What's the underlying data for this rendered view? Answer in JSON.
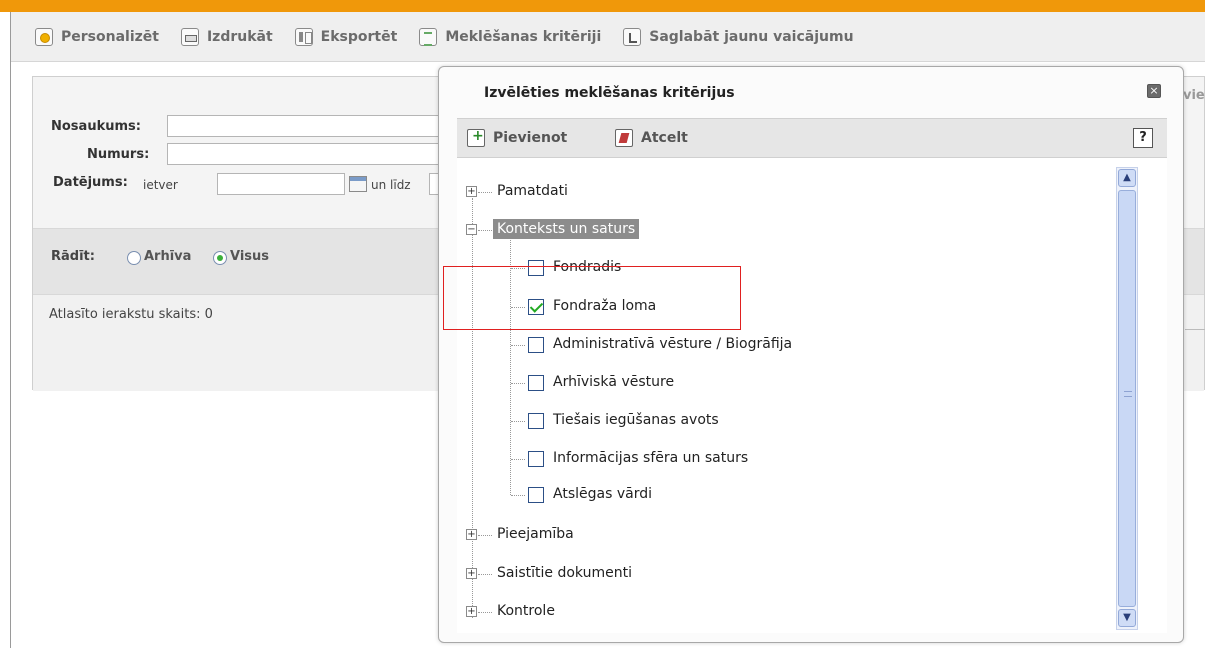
{
  "toolbar": {
    "personalize": "Personalizēt",
    "print": "Izdrukāt",
    "export": "Eksportēt",
    "criteria": "Meklēšanas kritēriji",
    "save_query": "Saglabāt jaunu vaicājumu"
  },
  "form": {
    "name_label": "Nosaukums:",
    "number_label": "Numurs:",
    "date_label": "Datējums:",
    "date_mode": "ietver",
    "date_to": "un līdz"
  },
  "show": {
    "label": "Rādīt:",
    "archive": "Arhīva",
    "all": "Visus"
  },
  "count_label": "Atlasīto ierakstu skaits: 0",
  "side_peek": "vie",
  "modal": {
    "title": "Izvēlēties meklēšanas kritērijus",
    "close": "×",
    "add_label": "Pievienot",
    "cancel_label": "Atcelt",
    "help": "?"
  },
  "tree": {
    "expand_plus": "+",
    "expand_minus": "−",
    "basic": "Pamatdati",
    "context": "Konteksts un saturs",
    "children": [
      {
        "label": "Fondradis",
        "checked": false
      },
      {
        "label": "Fondraža loma",
        "checked": true
      },
      {
        "label": "Administratīvā vēsture / Biogrāfija",
        "checked": false
      },
      {
        "label": "Arhīviskā vēsture",
        "checked": false
      },
      {
        "label": "Tiešais iegūšanas avots",
        "checked": false
      },
      {
        "label": "Informācijas sfēra un saturs",
        "checked": false
      },
      {
        "label": "Atslēgas vārdi",
        "checked": false
      }
    ],
    "access": "Pieejamība",
    "related": "Saistītie dokumenti",
    "control": "Kontrole"
  },
  "scroll": {
    "up": "▲",
    "down": "▼"
  }
}
